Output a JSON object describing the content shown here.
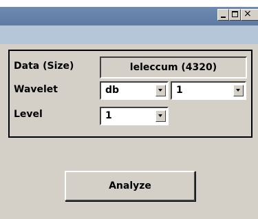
{
  "window": {
    "minimize_glyph": "_",
    "maximize_glyph": "□",
    "close_glyph": "×"
  },
  "data_row": {
    "label": "Data  (Size)",
    "value": "leleccum  (4320)"
  },
  "wavelet_row": {
    "label": "Wavelet",
    "family_value": "db",
    "order_value": "1"
  },
  "level_row": {
    "label": "Level",
    "level_value": "1"
  },
  "actions": {
    "analyze_label": "Analyze"
  },
  "colors": {
    "titlebar": "#6f8ab0",
    "menubar": "#b5c6d9",
    "client": "#d4d0c8"
  }
}
